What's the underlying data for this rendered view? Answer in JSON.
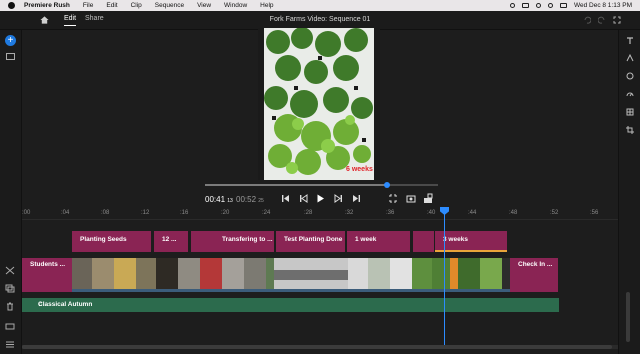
{
  "menubar": {
    "app_name": "Premiere Rush",
    "items": [
      "File",
      "Edit",
      "Clip",
      "Sequence",
      "View",
      "Window",
      "Help"
    ],
    "datetime": "Wed Dec 8  1:13 PM"
  },
  "header": {
    "tabs": [
      {
        "label": "Edit",
        "active": true
      },
      {
        "label": "Share",
        "active": false
      }
    ],
    "title": "Fork Farms Video: Sequence 01"
  },
  "preview": {
    "overlay_text": "6 weeks"
  },
  "transport": {
    "current_time": "00:41",
    "current_frames": "13",
    "duration_time": "00:52",
    "duration_frames": "25",
    "scrub_progress": 0.78
  },
  "ruler": {
    "ticks": [
      ":00",
      ":04",
      ":08",
      ":12",
      ":16",
      ":20",
      ":24",
      ":28",
      ":32",
      ":36",
      ":40",
      ":44",
      ":48",
      ":52",
      ":56"
    ]
  },
  "title_track": {
    "clips": [
      {
        "label": "Planting Seeds"
      },
      {
        "label": "12 ..."
      },
      {
        "label": ""
      },
      {
        "label": "Transfering to ..."
      },
      {
        "label": "Test Planting Done"
      },
      {
        "label": "1 week"
      },
      {
        "label": ""
      },
      {
        "label": "3 weeks"
      }
    ]
  },
  "video_track": {
    "clips": [
      {
        "label": "Students ..."
      },
      {
        "label": "Check In ..."
      }
    ]
  },
  "audio_track": {
    "label": "Classical Autumn"
  },
  "colors": {
    "accent": "#2d8cff",
    "title_clip": "#8a2454",
    "audio_clip": "#2c6b4d",
    "selection": "#e9a43a"
  }
}
